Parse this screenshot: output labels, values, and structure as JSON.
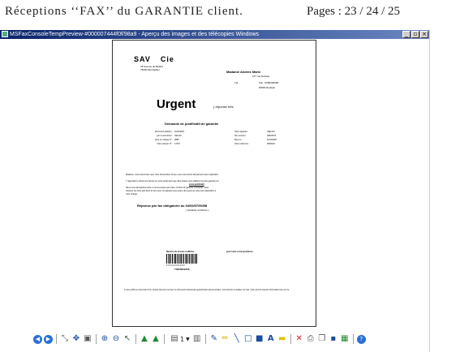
{
  "caption": {
    "title": "Réceptions ‘‘FAX’’ du GARANTIE client.",
    "pages": "Pages : 23 / 24 / 25"
  },
  "window": {
    "title": "MSFaxConsoleTempPreview-#000007444f0f/98a9 - Aperçu des images et des télécopies Windows",
    "buttons": {
      "minimize": "_",
      "maximize": "▫",
      "close": "×"
    }
  },
  "fax": {
    "company": "SAV",
    "company_suffix": "Cie",
    "company_addr1": "78 Avenue du Batard",
    "company_addr2": "75000 Montpellier",
    "recipient_name": "Madame Anders Marie",
    "recipient_addr": "127 rue Désirée",
    "recipient_tel": "Tél. :",
    "recipient_fax": "Fax : 0000000000",
    "recipient_city": "00000 Roubaix",
    "urgent": "Urgent",
    "urgent_note": "( réponse très",
    "demande": "Demande de justificatif de garantie",
    "fields": [
      {
        "label": "Document établi le :",
        "value": "11/10/2007",
        "rlabel": "Votre appareil :",
        "rvalue": "CIE1212"
      },
      {
        "label": "par le technicien :",
        "value": "Valentin",
        "rlabel": "Nos numéro :",
        "rvalue": "00022670"
      },
      {
        "label": "prise en charge N° :",
        "value": "2895",
        "rlabel": "Reçu le :",
        "rvalue": "11/10/2007"
      },
      {
        "label": "Votre dossier N° :",
        "value": "17472",
        "rlabel": "Votre référence :",
        "rvalue": "0000002"
      }
    ],
    "body_line1": "Madame, nous avons bien reçu votre intervention 22 qui, nous vous avons fait parvenir pour réparation.",
    "body_line2": "Y apportant le document dévolu en votre achat ainsi que dans lequel vous établirez la votre garantie sur",
    "body_underlined": "votre justificatif",
    "body_line3": "Nous vous demandons donc et nous évoque par retour, la fiche de garantie complétée, avec",
    "body_line4": "dessous de votre part dans le bien pour cet appareil sous peine des quels de cette inter déposition à",
    "body_line5": "votre charge.",
    "reponse": "Réponse par fax obligatoire au 04/93/07/90/98",
    "reponse_sub": "( Garantie et facture )",
    "barcode_label": "Numéro de dossier à afficher",
    "barcode_nums": "F 0 0 0 0 2 8 3 2 5 6",
    "barcode_id": "T0000002406",
    "cachet": "pour toute correspondance :",
    "footer": "Il vous suffit au retournant d'un simple fait pour envoyer ce document intéressant garantissant documentaire, Ceci doit les à réaliser sur site, votre accord suivant information bien sur le."
  },
  "toolbar": {
    "buttons": [
      "previous-image",
      "next-image",
      "separator",
      "best-fit",
      "actual-size",
      "fit-window",
      "separator",
      "zoom-in",
      "zoom-out",
      "select",
      "separator",
      "rotate-clockwise",
      "rotate-counterclockwise",
      "separator",
      "page-select",
      "next-page",
      "separator",
      "pen",
      "highlighter",
      "line",
      "rectangle",
      "filled-rectangle",
      "text",
      "note",
      "separator",
      "delete",
      "print",
      "copy",
      "save",
      "export",
      "separator",
      "help"
    ],
    "page_value": "1"
  }
}
